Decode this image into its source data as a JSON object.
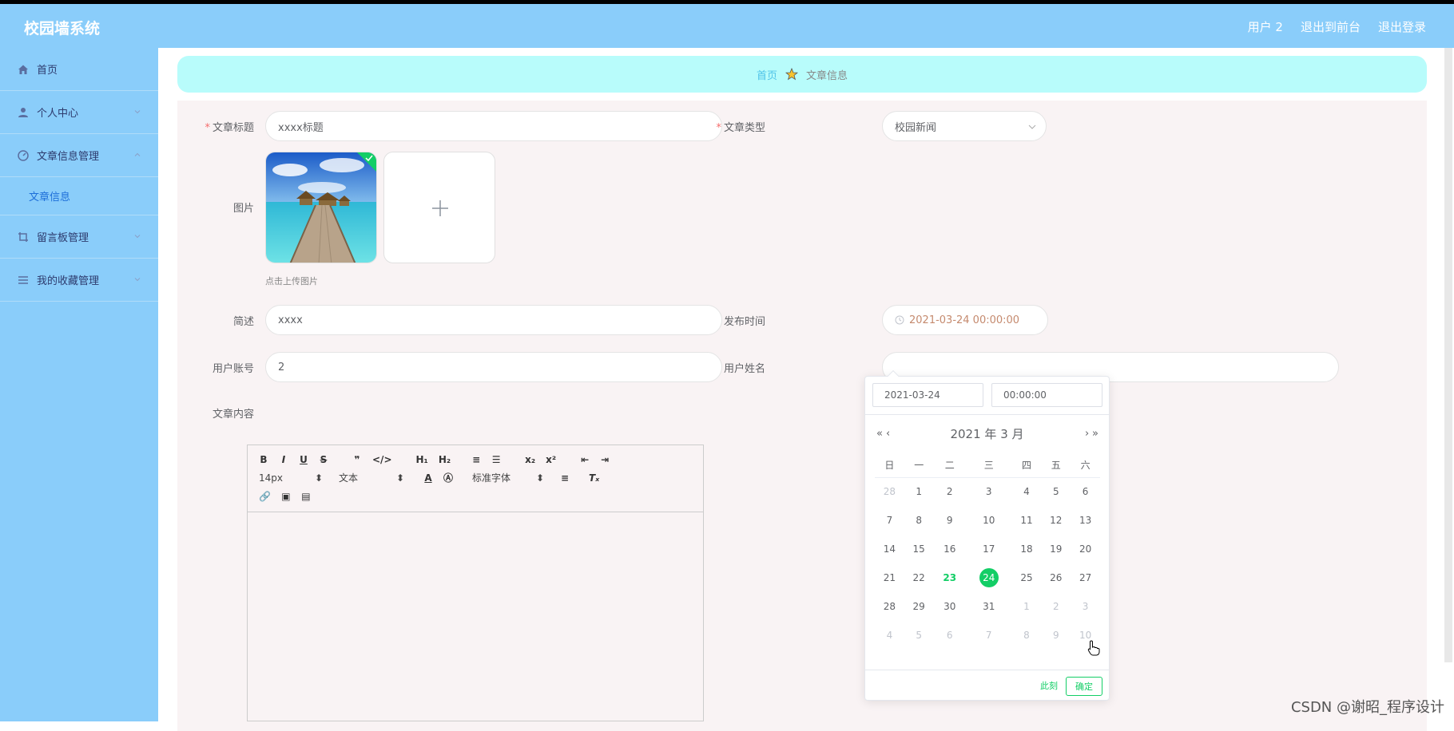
{
  "app": {
    "title": "校园墙系统"
  },
  "header": {
    "user": "用户 2",
    "goto_front": "退出到前台",
    "logout": "退出登录"
  },
  "sidebar": {
    "items": [
      {
        "label": "首页",
        "icon": "home-icon"
      },
      {
        "label": "个人中心",
        "icon": "user-icon"
      },
      {
        "label": "文章信息管理",
        "icon": "dashboard-icon"
      },
      {
        "label": "留言板管理",
        "icon": "crop-icon"
      },
      {
        "label": "我的收藏管理",
        "icon": "menu-icon"
      }
    ],
    "sub_item": "文章信息"
  },
  "breadcrumb": {
    "home": "首页",
    "current": "文章信息"
  },
  "form": {
    "title_label": "文章标题",
    "title_value": "xxxx标题",
    "type_label": "文章类型",
    "type_value": "校园新闻",
    "image_label": "图片",
    "upload_hint": "点击上传图片",
    "summary_label": "简述",
    "summary_value": "xxxx",
    "publish_label": "发布时间",
    "publish_value": "2021-03-24 00:00:00",
    "account_label": "用户账号",
    "account_value": "2",
    "username_label": "用户姓名",
    "username_value": "",
    "content_label": "文章内容"
  },
  "editor": {
    "font_size": "14px",
    "block_type": "文本",
    "font_family": "标准字体"
  },
  "datepicker": {
    "date_value": "2021-03-24",
    "time_value": "00:00:00",
    "year_label": "2021 年",
    "month_label": "3 月",
    "weekdays": [
      "日",
      "一",
      "二",
      "三",
      "四",
      "五",
      "六"
    ],
    "weeks": [
      [
        "28",
        "1",
        "2",
        "3",
        "4",
        "5",
        "6"
      ],
      [
        "7",
        "8",
        "9",
        "10",
        "11",
        "12",
        "13"
      ],
      [
        "14",
        "15",
        "16",
        "17",
        "18",
        "19",
        "20"
      ],
      [
        "21",
        "22",
        "23",
        "24",
        "25",
        "26",
        "27"
      ],
      [
        "28",
        "29",
        "30",
        "31",
        "1",
        "2",
        "3"
      ],
      [
        "4",
        "5",
        "6",
        "7",
        "8",
        "9",
        "10"
      ]
    ],
    "today": "23",
    "selected": "24",
    "now_label": "此刻",
    "confirm_label": "确定"
  },
  "watermark": "CSDN @谢昭_程序设计",
  "colors": {
    "header": "#8acdfa",
    "accent": "#13ce66",
    "breadcrumb_bg": "#b8fcfb"
  }
}
